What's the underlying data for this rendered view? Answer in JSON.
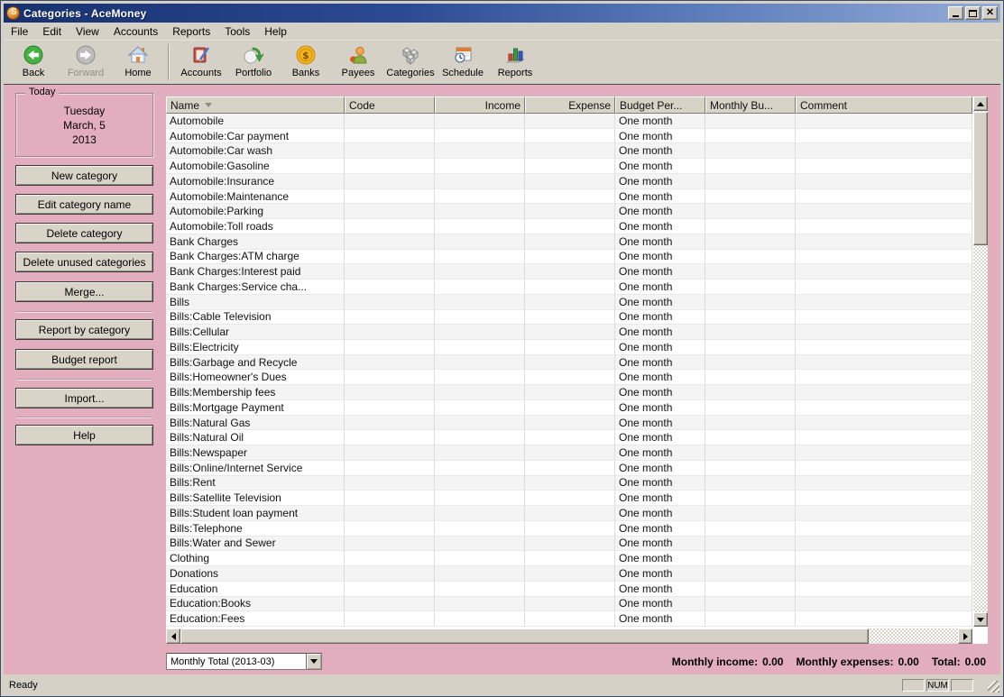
{
  "window": {
    "title": "Categories - AceMoney"
  },
  "menu": {
    "items": [
      "File",
      "Edit",
      "View",
      "Accounts",
      "Reports",
      "Tools",
      "Help"
    ]
  },
  "toolbar": {
    "items": [
      {
        "label": "Back",
        "icon": "back-icon",
        "enabled": true
      },
      {
        "label": "Forward",
        "icon": "forward-icon",
        "enabled": false
      },
      {
        "label": "Home",
        "icon": "home-icon",
        "enabled": true
      },
      {
        "label": "Accounts",
        "icon": "accounts-icon",
        "enabled": true
      },
      {
        "label": "Portfolio",
        "icon": "portfolio-icon",
        "enabled": true
      },
      {
        "label": "Banks",
        "icon": "banks-icon",
        "enabled": true
      },
      {
        "label": "Payees",
        "icon": "payees-icon",
        "enabled": true
      },
      {
        "label": "Categories",
        "icon": "categories-icon",
        "enabled": true
      },
      {
        "label": "Schedule",
        "icon": "schedule-icon",
        "enabled": true
      },
      {
        "label": "Reports",
        "icon": "reports-icon",
        "enabled": true
      }
    ]
  },
  "sidebar": {
    "today": {
      "label": "Today",
      "lines": [
        "Tuesday",
        "March, 5",
        "2013"
      ]
    },
    "buttons": [
      "New category",
      "Edit category name",
      "Delete category",
      "Delete unused categories",
      "Merge...",
      "Report by category",
      "Budget report",
      "Import...",
      "Help"
    ]
  },
  "table": {
    "columns": [
      {
        "label": "Name",
        "sorted": "desc"
      },
      {
        "label": "Code"
      },
      {
        "label": "Income"
      },
      {
        "label": "Expense"
      },
      {
        "label": "Budget Per..."
      },
      {
        "label": "Monthly Bu..."
      },
      {
        "label": "Comment"
      }
    ],
    "rows": [
      {
        "name": "Automobile",
        "budget_period": "One month"
      },
      {
        "name": "Automobile:Car payment",
        "budget_period": "One month"
      },
      {
        "name": "Automobile:Car wash",
        "budget_period": "One month"
      },
      {
        "name": "Automobile:Gasoline",
        "budget_period": "One month"
      },
      {
        "name": "Automobile:Insurance",
        "budget_period": "One month"
      },
      {
        "name": "Automobile:Maintenance",
        "budget_period": "One month"
      },
      {
        "name": "Automobile:Parking",
        "budget_period": "One month"
      },
      {
        "name": "Automobile:Toll roads",
        "budget_period": "One month"
      },
      {
        "name": "Bank Charges",
        "budget_period": "One month"
      },
      {
        "name": "Bank Charges:ATM charge",
        "budget_period": "One month"
      },
      {
        "name": "Bank Charges:Interest paid",
        "budget_period": "One month"
      },
      {
        "name": "Bank Charges:Service cha...",
        "budget_period": "One month"
      },
      {
        "name": "Bills",
        "budget_period": "One month"
      },
      {
        "name": "Bills:Cable Television",
        "budget_period": "One month"
      },
      {
        "name": "Bills:Cellular",
        "budget_period": "One month"
      },
      {
        "name": "Bills:Electricity",
        "budget_period": "One month"
      },
      {
        "name": "Bills:Garbage and Recycle",
        "budget_period": "One month"
      },
      {
        "name": "Bills:Homeowner's Dues",
        "budget_period": "One month"
      },
      {
        "name": "Bills:Membership fees",
        "budget_period": "One month"
      },
      {
        "name": "Bills:Mortgage Payment",
        "budget_period": "One month"
      },
      {
        "name": "Bills:Natural Gas",
        "budget_period": "One month"
      },
      {
        "name": "Bills:Natural Oil",
        "budget_period": "One month"
      },
      {
        "name": "Bills:Newspaper",
        "budget_period": "One month"
      },
      {
        "name": "Bills:Online/Internet Service",
        "budget_period": "One month"
      },
      {
        "name": "Bills:Rent",
        "budget_period": "One month"
      },
      {
        "name": "Bills:Satellite Television",
        "budget_period": "One month"
      },
      {
        "name": "Bills:Student loan payment",
        "budget_period": "One month"
      },
      {
        "name": "Bills:Telephone",
        "budget_period": "One month"
      },
      {
        "name": "Bills:Water and Sewer",
        "budget_period": "One month"
      },
      {
        "name": "Clothing",
        "budget_period": "One month"
      },
      {
        "name": "Donations",
        "budget_period": "One month"
      },
      {
        "name": "Education",
        "budget_period": "One month"
      },
      {
        "name": "Education:Books",
        "budget_period": "One month"
      },
      {
        "name": "Education:Fees",
        "budget_period": "One month"
      }
    ]
  },
  "footer": {
    "period_selector": "Monthly Total (2013-03)",
    "monthly_income_label": "Monthly income:",
    "monthly_income": "0.00",
    "monthly_expenses_label": "Monthly expenses:",
    "monthly_expenses": "0.00",
    "total_label": "Total:",
    "total": "0.00"
  },
  "statusbar": {
    "status": "Ready",
    "num_lock": "NUM"
  },
  "colors": {
    "sidebar_pink": "#e3adc0",
    "chrome_gray": "#d5d1c6",
    "titlebar_blue": "#2c4a94"
  }
}
